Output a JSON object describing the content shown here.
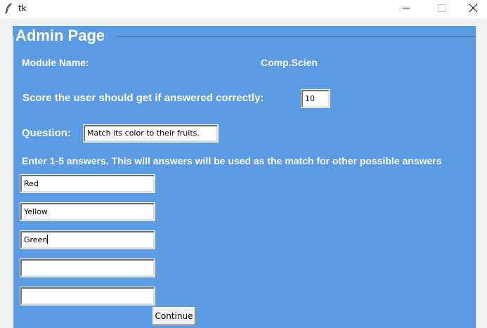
{
  "window": {
    "title": "tk"
  },
  "frame": {
    "title": "Admin Page"
  },
  "module": {
    "label": "Module Name:",
    "value": "Comp.Scien"
  },
  "score": {
    "label": "Score the user should get if  answered correctly:",
    "value": "10"
  },
  "question": {
    "label": "Question:",
    "value": "Match its color to their fruits."
  },
  "answers": {
    "instruction": "Enter 1-5 answers. This will answers will be used as the match for other possible answers",
    "items": [
      "Red",
      "Yellow",
      "Green",
      "",
      ""
    ]
  },
  "continue_label": "Continue",
  "colors": {
    "frame_bg": "#5b9be4",
    "label_text": "#ffffff"
  }
}
